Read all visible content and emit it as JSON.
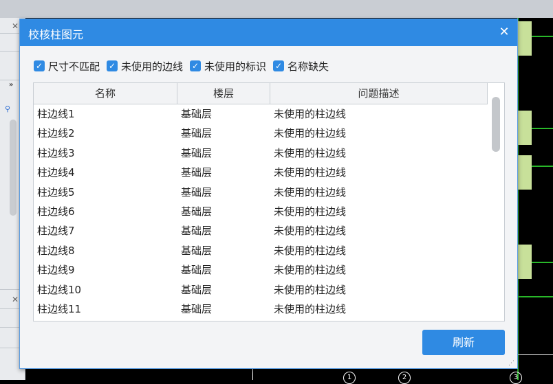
{
  "dialog": {
    "title": "校核柱图元",
    "close_icon": "close-icon",
    "filters": [
      {
        "label": "尺寸不匹配",
        "checked": true
      },
      {
        "label": "未使用的边线",
        "checked": true
      },
      {
        "label": "未使用的标识",
        "checked": true
      },
      {
        "label": "名称缺失",
        "checked": true
      }
    ],
    "table": {
      "headers": [
        "名称",
        "楼层",
        "问题描述"
      ],
      "rows": [
        [
          "柱边线1",
          "基础层",
          "未使用的柱边线"
        ],
        [
          "柱边线2",
          "基础层",
          "未使用的柱边线"
        ],
        [
          "柱边线3",
          "基础层",
          "未使用的柱边线"
        ],
        [
          "柱边线4",
          "基础层",
          "未使用的柱边线"
        ],
        [
          "柱边线5",
          "基础层",
          "未使用的柱边线"
        ],
        [
          "柱边线6",
          "基础层",
          "未使用的柱边线"
        ],
        [
          "柱边线7",
          "基础层",
          "未使用的柱边线"
        ],
        [
          "柱边线8",
          "基础层",
          "未使用的柱边线"
        ],
        [
          "柱边线9",
          "基础层",
          "未使用的柱边线"
        ],
        [
          "柱边线10",
          "基础层",
          "未使用的柱边线"
        ],
        [
          "柱边线11",
          "基础层",
          "未使用的柱边线"
        ]
      ]
    },
    "refresh_label": "刷新"
  },
  "colors": {
    "accent": "#2f8ae3",
    "cad_background": "#000000",
    "cad_line": "#29b829",
    "column_fill": "#c8e09a"
  }
}
